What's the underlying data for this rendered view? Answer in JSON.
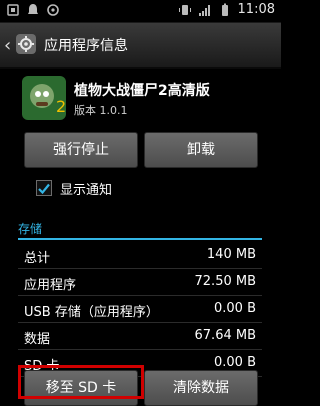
{
  "status_bar": {
    "time": "11:08"
  },
  "header": {
    "title": "应用程序信息"
  },
  "app": {
    "name": "植物大战僵尸2高清版",
    "version": "版本 1.0.1"
  },
  "buttons": {
    "force_stop": "强行停止",
    "uninstall": "卸载",
    "move_to_sd": "移至 SD 卡",
    "clear_data": "清除数据"
  },
  "notifications": {
    "label": "显示通知",
    "checked": true
  },
  "storage": {
    "title": "存储",
    "rows": [
      {
        "label": "总计",
        "value": "140 MB"
      },
      {
        "label": "应用程序",
        "value": "72.50 MB"
      },
      {
        "label": "USB 存储（应用程序）",
        "value": "0.00 B"
      },
      {
        "label": "数据",
        "value": "67.64 MB"
      },
      {
        "label": "SD 卡",
        "value": "0.00 B"
      }
    ]
  },
  "colors": {
    "accent": "#33b5e5",
    "highlight": "#d00000",
    "button": "#5a5a5a"
  }
}
